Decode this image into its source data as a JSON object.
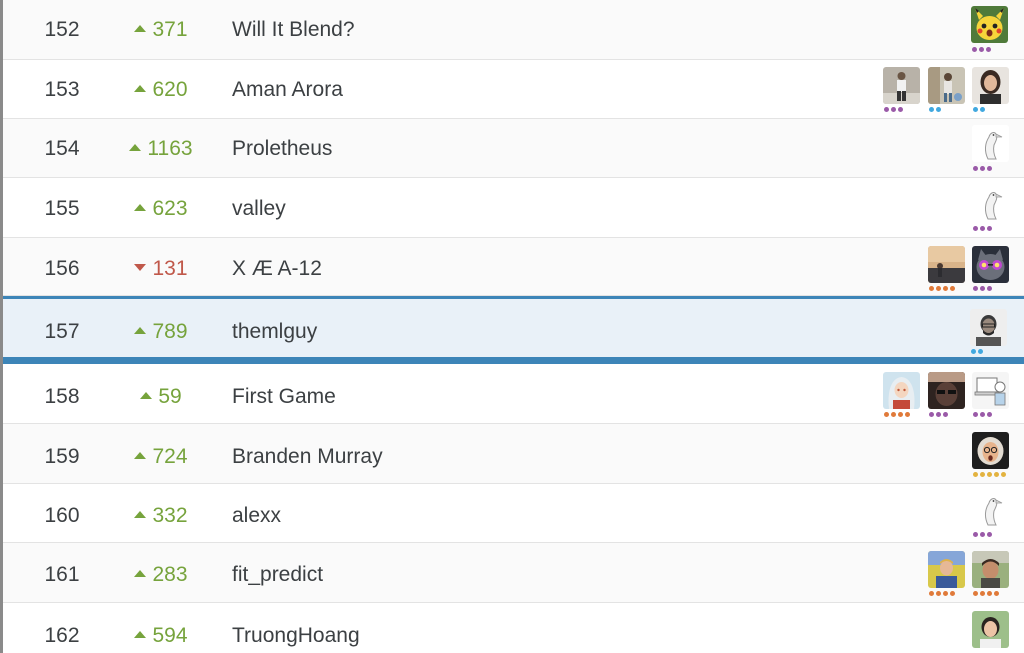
{
  "rows": [
    {
      "rank": "152",
      "change": "371",
      "direction": "up",
      "team": "Will It Blend?"
    },
    {
      "rank": "153",
      "change": "620",
      "direction": "up",
      "team": "Aman Arora"
    },
    {
      "rank": "154",
      "change": "1163",
      "direction": "up",
      "team": "Proletheus"
    },
    {
      "rank": "155",
      "change": "623",
      "direction": "up",
      "team": "valley"
    },
    {
      "rank": "156",
      "change": "131",
      "direction": "down",
      "team": "X Æ A-12"
    },
    {
      "rank": "157",
      "change": "789",
      "direction": "up",
      "team": "themlguy"
    },
    {
      "rank": "158",
      "change": "59",
      "direction": "up",
      "team": "First Game"
    },
    {
      "rank": "159",
      "change": "724",
      "direction": "up",
      "team": "Branden Murray"
    },
    {
      "rank": "160",
      "change": "332",
      "direction": "up",
      "team": "alexx"
    },
    {
      "rank": "161",
      "change": "283",
      "direction": "up",
      "team": "fit_predict"
    },
    {
      "rank": "162",
      "change": "594",
      "direction": "up",
      "team": "TruongHoang"
    }
  ],
  "colors": {
    "up": "#76a33c",
    "down": "#c0584a",
    "highlight_border": "#3d85b8",
    "highlight_bg": "#e9f1f8",
    "tier_contributor": "#9a5aa8",
    "tier_novice": "#41a8df",
    "tier_expert": "#e07a3a",
    "tier_grandmaster": "#e3b340"
  }
}
